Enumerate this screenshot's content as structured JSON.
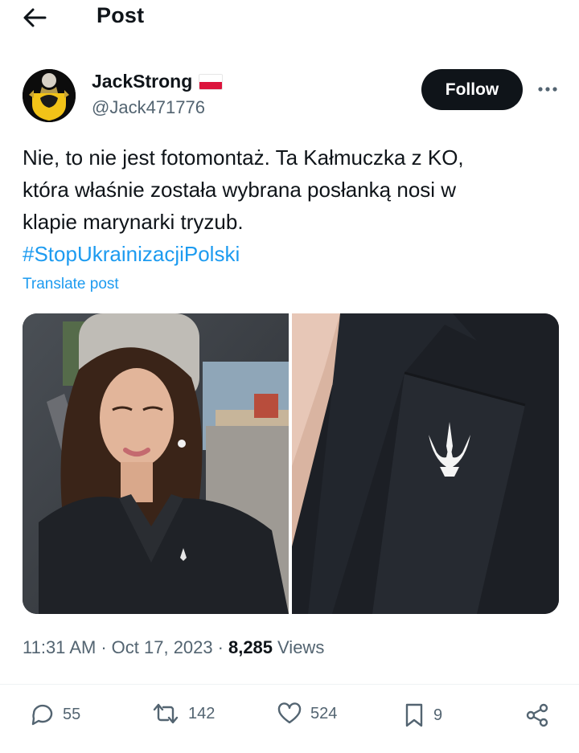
{
  "header": {
    "title": "Post"
  },
  "author": {
    "display_name": "JackStrong",
    "handle": "@Jack471776",
    "flag_colors": [
      "#ffffff",
      "#dc143c"
    ]
  },
  "follow": {
    "label": "Follow"
  },
  "post": {
    "text_lines": [
      "Nie, to nie jest fotomontaż. Ta Kałmuczka z KO,",
      "która właśnie została wybrana posłanką nosi w",
      "klapie marynarki tryzub."
    ],
    "hashtag": "#StopUkrainizacjiPolski",
    "translate_label": "Translate post"
  },
  "meta": {
    "time": "11:31 AM",
    "date": "Oct 17, 2023",
    "views_count": "8,285",
    "views_label": "Views"
  },
  "actions": {
    "replies": "55",
    "reposts": "142",
    "likes": "524",
    "bookmarks": "9"
  },
  "colors": {
    "accent": "#1d9bf0",
    "text": "#0f1419",
    "secondary": "#536471"
  },
  "icons": {
    "back": "arrow-left-icon",
    "more": "more-icon",
    "reply": "reply-icon",
    "repost": "repost-icon",
    "like": "heart-icon",
    "bookmark": "bookmark-icon",
    "share": "share-icon"
  }
}
